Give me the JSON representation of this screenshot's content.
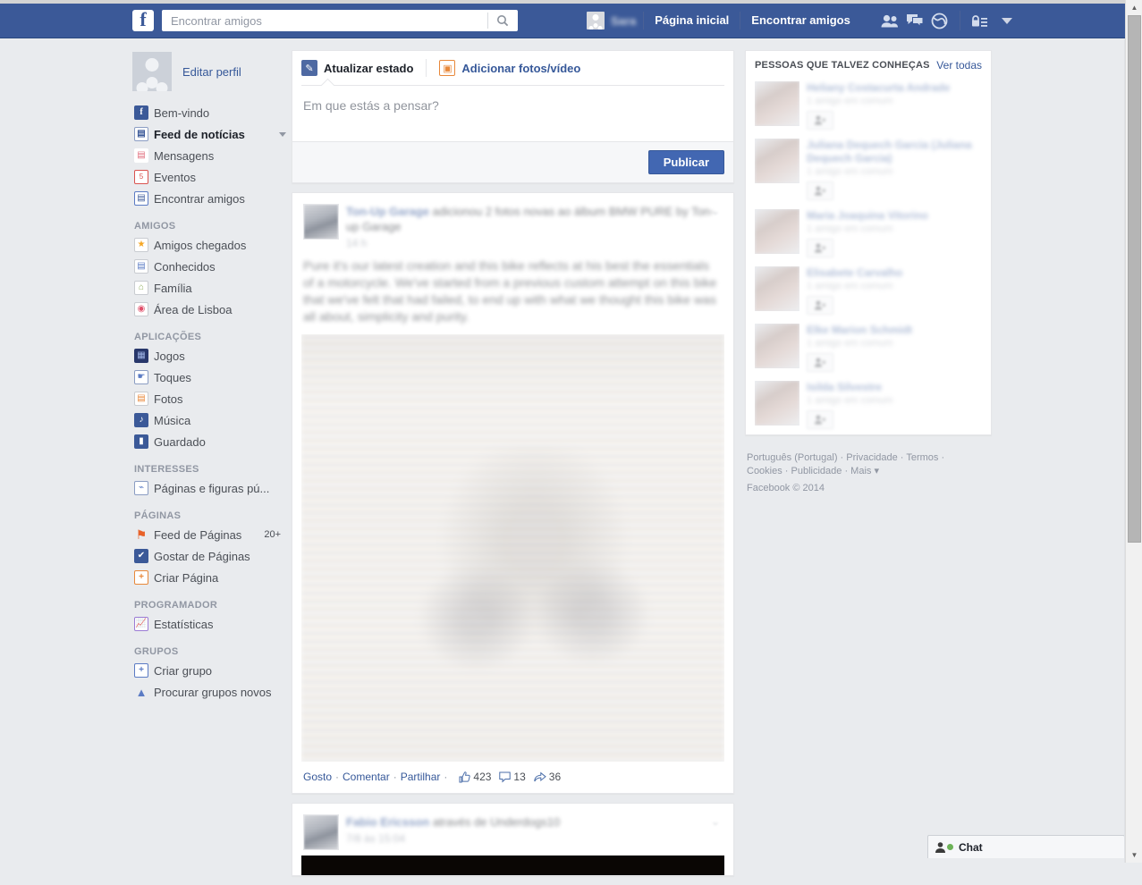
{
  "topbar": {
    "logo": "f",
    "search": {
      "placeholder": "Encontrar amigos",
      "value": "",
      "icon": "search-icon"
    },
    "me_name": "Sara",
    "links": [
      {
        "label": "Página inicial"
      },
      {
        "label": "Encontrar amigos"
      }
    ],
    "icons": [
      {
        "name": "friend-requests-icon"
      },
      {
        "name": "messages-icon"
      },
      {
        "name": "notifications-globe-icon"
      },
      {
        "name": "privacy-lock-icon"
      },
      {
        "name": "account-chevron-down-icon"
      }
    ]
  },
  "sidebar": {
    "edit_profile": "Editar perfil",
    "items": [
      {
        "label": "Bem-vindo",
        "icon": "facebook-f-icon",
        "cls": "ic-blue",
        "glyph": "f",
        "active": false
      },
      {
        "label": "Feed de notícias",
        "icon": "news-feed-icon",
        "cls": "ic-news",
        "glyph": "▤",
        "active": true,
        "caret": true
      },
      {
        "label": "Mensagens",
        "icon": "messages-icon",
        "cls": "ic-msg",
        "glyph": "▤",
        "active": false
      },
      {
        "label": "Eventos",
        "icon": "events-calendar-icon",
        "cls": "ic-evt",
        "glyph": "5",
        "active": false
      },
      {
        "label": "Encontrar amigos",
        "icon": "find-friends-icon",
        "cls": "ic-ff",
        "glyph": "▤",
        "active": false
      }
    ],
    "sections": [
      {
        "head": "AMIGOS",
        "items": [
          {
            "label": "Amigos chegados",
            "icon": "close-friends-star-icon",
            "cls": "ic-star",
            "glyph": "★"
          },
          {
            "label": "Conhecidos",
            "icon": "acquaintances-icon",
            "cls": "ic-acq",
            "glyph": "▤"
          },
          {
            "label": "Família",
            "icon": "family-house-icon",
            "cls": "ic-fam",
            "glyph": "⌂"
          },
          {
            "label": "Área de Lisboa",
            "icon": "location-pin-icon",
            "cls": "ic-loc",
            "glyph": "◉"
          }
        ]
      },
      {
        "head": "APLICAÇÕES",
        "items": [
          {
            "label": "Jogos",
            "icon": "games-icon",
            "cls": "ic-games",
            "glyph": "▦"
          },
          {
            "label": "Toques",
            "icon": "pokes-icon",
            "cls": "ic-poke",
            "glyph": "☛"
          },
          {
            "label": "Fotos",
            "icon": "photos-icon",
            "cls": "ic-photos",
            "glyph": "▤"
          },
          {
            "label": "Música",
            "icon": "music-note-icon",
            "cls": "ic-music",
            "glyph": "♪"
          },
          {
            "label": "Guardado",
            "icon": "saved-bookmark-icon",
            "cls": "ic-saved",
            "glyph": "▮"
          }
        ]
      },
      {
        "head": "INTERESSES",
        "items": [
          {
            "label": "Páginas e figuras pú...",
            "icon": "rss-feed-icon",
            "cls": "ic-rss",
            "glyph": "⌁"
          }
        ]
      },
      {
        "head": "PÁGINAS",
        "items": [
          {
            "label": "Feed de Páginas",
            "icon": "pages-feed-flag-icon",
            "cls": "ic-flag",
            "glyph": "⚑",
            "count": "20+"
          },
          {
            "label": "Gostar de Páginas",
            "icon": "thumbs-up-icon",
            "cls": "ic-like",
            "glyph": "✔"
          },
          {
            "label": "Criar Página",
            "icon": "create-page-plus-icon",
            "cls": "ic-plus-o",
            "glyph": "+"
          }
        ]
      },
      {
        "head": "PROGRAMADOR",
        "items": [
          {
            "label": "Estatísticas",
            "icon": "insights-chart-icon",
            "cls": "ic-stats",
            "glyph": "📈"
          }
        ]
      },
      {
        "head": "GRUPOS",
        "items": [
          {
            "label": "Criar grupo",
            "icon": "create-group-plus-icon",
            "cls": "ic-plus-b",
            "glyph": "+"
          },
          {
            "label": "Procurar grupos novos",
            "icon": "discover-groups-rocket-icon",
            "cls": "ic-rocket",
            "glyph": "▲"
          }
        ]
      }
    ]
  },
  "composer": {
    "tab_status": "Atualizar estado",
    "tab_photo": "Adicionar fotos/vídeo",
    "placeholder": "Em que estás a pensar?",
    "post_button": "Publicar"
  },
  "feed": {
    "posts": [
      {
        "author": "Ton-Up Garage",
        "action": " adicionou 2 fotos novas ao álbum BMW PURE by Ton-up Garage",
        "time": "14 h",
        "text": "Pure it's our latest creation and this bike reflects at his best the essentials of a motorcycle. We've started from a previous custom attempt on this bike that we've felt that had failed, to end up with what we thought this bike was all about, simplicity and purity.",
        "actions": {
          "like": "Gosto",
          "comment": "Comentar",
          "share": "Partilhar"
        },
        "stats": {
          "likes": "423",
          "comments": "13",
          "shares": "36"
        }
      },
      {
        "author": "Fabio Ericsson",
        "action": " através de Underdogs10",
        "time": "7/8 às 15:04"
      }
    ]
  },
  "right": {
    "pymk_title": "PESSOAS QUE TALVEZ CONHEÇAS",
    "pymk_see_all": "Ver todas",
    "people": [
      {
        "name": "Heliany Costacurta Andrade",
        "mutual": "1 amigo em comum",
        "add": "Adicionar"
      },
      {
        "name": "Juliana Dequech Garcia (Juliana Dequech Garcia)",
        "mutual": "1 amigo em comum",
        "add": "Adicionar"
      },
      {
        "name": "Maria Joaquina Vitorino",
        "mutual": "1 amigo em comum",
        "add": "Adicionar"
      },
      {
        "name": "Elisabete Carvalho",
        "mutual": "1 amigo em comum",
        "add": "Adicionar"
      },
      {
        "name": "Elke Marion Schmidt",
        "mutual": "1 amigo em comum",
        "add": "Adicionar"
      },
      {
        "name": "Isilda Silvestre",
        "mutual": "1 amigo em comum",
        "add": "Adicionar"
      }
    ],
    "footer": {
      "line1": "Português (Portugal) · Privacidade · Termos ·",
      "line2": "Cookies · Publicidade · Mais ",
      "copyright": "Facebook © 2014"
    }
  },
  "chat": {
    "label": "Chat"
  },
  "colors": {
    "brand_blue": "#3b5998",
    "link_blue": "#365899",
    "page_bg": "#e9ebee",
    "button_blue": "#4267b2",
    "online_green": "#6cb257"
  }
}
